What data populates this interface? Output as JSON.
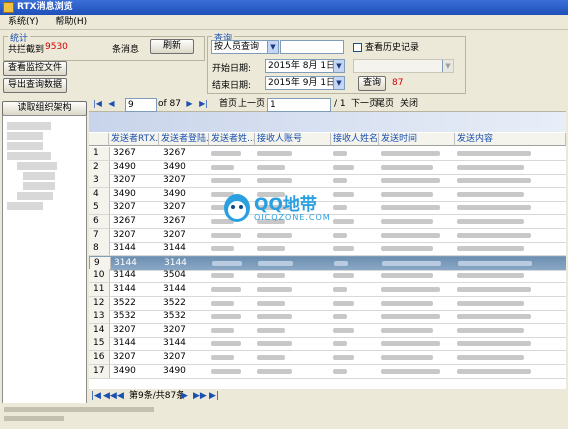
{
  "window": {
    "title": "RTX消息浏览"
  },
  "menu": [
    {
      "label": "系统(Y)"
    },
    {
      "label": "帮助(H)"
    }
  ],
  "stats": {
    "group_title": "统计",
    "intercept_label": "共拦截到",
    "intercept_count": "9530",
    "unit_label": "条消息",
    "refresh_label": "刷新"
  },
  "left_buttons": {
    "view_monitor": "查看监控文件",
    "export": "导出查询数据",
    "read_org": "读取组织架构"
  },
  "query": {
    "group_title": "查询",
    "mode_value": "按人员查询",
    "history_label": "查看历史记录",
    "start_label": "开始日期:",
    "start_value": "2015年 8月 1日",
    "end_label": "结束日期:",
    "end_value": "2015年 9月 1日",
    "query_button": "查询",
    "result_count": "87"
  },
  "nav": {
    "page_input": "9",
    "of_label": "of 87",
    "first_page": "首页",
    "prev_page": "上一页",
    "page_field": "1",
    "total_pages": "/ 1",
    "next_page": "下一页",
    "last_page": "尾页",
    "close": "关闭"
  },
  "table": {
    "columns": [
      "发送者RTX...",
      "发送者登陆...",
      "发送者姓...",
      "接收人账号",
      "接收人姓名",
      "发送时间",
      "发送内容"
    ],
    "rows": [
      {
        "idx": "1",
        "a": "3267",
        "b": "3267"
      },
      {
        "idx": "2",
        "a": "3490",
        "b": "3490"
      },
      {
        "idx": "3",
        "a": "3207",
        "b": "3207"
      },
      {
        "idx": "4",
        "a": "3490",
        "b": "3490"
      },
      {
        "idx": "5",
        "a": "3207",
        "b": "3207"
      },
      {
        "idx": "6",
        "a": "3267",
        "b": "3267"
      },
      {
        "idx": "7",
        "a": "3207",
        "b": "3207"
      },
      {
        "idx": "8",
        "a": "3144",
        "b": "3144"
      },
      {
        "idx": "9",
        "a": "3144",
        "b": "3144"
      },
      {
        "idx": "10",
        "a": "3144",
        "b": "3504"
      },
      {
        "idx": "11",
        "a": "3144",
        "b": "3144"
      },
      {
        "idx": "12",
        "a": "3522",
        "b": "3522"
      },
      {
        "idx": "13",
        "a": "3532",
        "b": "3532"
      },
      {
        "idx": "14",
        "a": "3207",
        "b": "3207"
      },
      {
        "idx": "15",
        "a": "3144",
        "b": "3144"
      },
      {
        "idx": "16",
        "a": "3207",
        "b": "3207"
      },
      {
        "idx": "17",
        "a": "3490",
        "b": "3490"
      }
    ]
  },
  "status": {
    "record": "第9条/共87条"
  },
  "watermark": {
    "brand": "QQ地带",
    "url": "OICQZONE.COM"
  },
  "colors": {
    "selected_row": "#7b9cbc",
    "header_text": "#1a50b0",
    "count_red": "#d00000"
  }
}
